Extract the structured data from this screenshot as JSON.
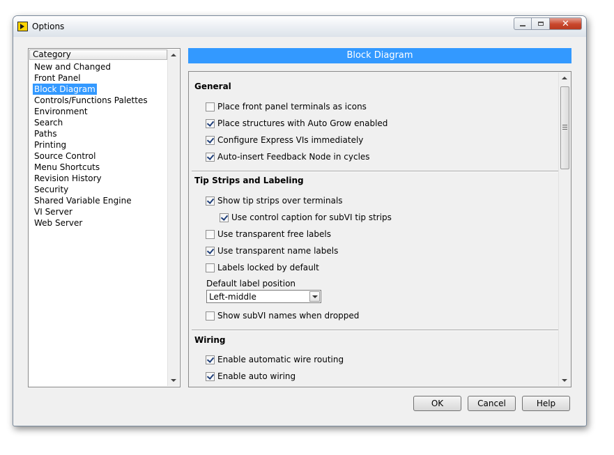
{
  "window": {
    "title": "Options",
    "close_glyph": "✕"
  },
  "category": {
    "header": "Category",
    "items": [
      "New and Changed",
      "Front Panel",
      "Block Diagram",
      "Controls/Functions Palettes",
      "Environment",
      "Search",
      "Paths",
      "Printing",
      "Source Control",
      "Menu Shortcuts",
      "Revision History",
      "Security",
      "Shared Variable Engine",
      "VI Server",
      "Web Server"
    ],
    "selected": "Block Diagram"
  },
  "panel": {
    "title": "Block Diagram",
    "general": {
      "heading": "General",
      "options": [
        {
          "label": "Place front panel terminals as icons",
          "checked": false
        },
        {
          "label": "Place structures with Auto Grow enabled",
          "checked": true
        },
        {
          "label": "Configure Express VIs immediately",
          "checked": true
        },
        {
          "label": "Auto-insert Feedback Node in cycles",
          "checked": true
        }
      ]
    },
    "tips": {
      "heading": "Tip Strips and Labeling",
      "options": [
        {
          "label": "Show tip strips over terminals",
          "checked": true
        },
        {
          "label": "Use control caption for subVI tip strips",
          "checked": true
        },
        {
          "label": "Use transparent free labels",
          "checked": false
        },
        {
          "label": "Use transparent name labels",
          "checked": true
        },
        {
          "label": "Labels locked by default",
          "checked": false
        }
      ],
      "label_position_label": "Default label position",
      "label_position_value": "Left-middle",
      "subvi_names": {
        "label": "Show subVI names when dropped",
        "checked": false
      }
    },
    "wiring": {
      "heading": "Wiring",
      "options": [
        {
          "label": "Enable automatic wire routing",
          "checked": true
        },
        {
          "label": "Enable auto wiring",
          "checked": true
        }
      ]
    }
  },
  "buttons": {
    "ok": "OK",
    "cancel": "Cancel",
    "help": "Help"
  },
  "colors": {
    "selection": "#3399ff",
    "close_button": "#c9462c"
  },
  "icons": [
    "labview-app-icon",
    "minimize-icon",
    "maximize-icon",
    "close-icon",
    "checkbox-icon",
    "chevron-down-icon",
    "scroll-up-icon",
    "scroll-down-icon"
  ]
}
